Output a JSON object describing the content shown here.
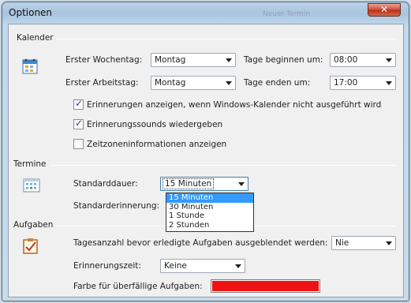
{
  "window": {
    "title": "Optionen",
    "ghost_title": "Neuer Termin"
  },
  "calendar": {
    "section_label": "Kalender",
    "first_weekday_label": "Erster Wochentag:",
    "first_weekday_value": "Montag",
    "first_workday_label": "Erster Arbeitstag:",
    "first_workday_value": "Montag",
    "day_start_label": "Tage beginnen um:",
    "day_start_value": "08:00",
    "day_end_label": "Tage enden um:",
    "day_end_value": "17:00",
    "checkboxes": [
      {
        "label": "Erinnerungen anzeigen, wenn Windows-Kalender nicht ausgeführt wird",
        "checked": true
      },
      {
        "label": "Erinnerungssounds wiedergeben",
        "checked": true
      },
      {
        "label": "Zeitzoneninformationen anzeigen",
        "checked": false
      }
    ]
  },
  "appointments": {
    "section_label": "Termine",
    "default_duration_label": "Standarddauer:",
    "default_duration_value": "15 Minuten",
    "default_reminder_label": "Standarderinnerung:",
    "duration_options": [
      "15 Minuten",
      "30 Minuten",
      "1 Stunde",
      "2 Stunden"
    ]
  },
  "tasks": {
    "section_label": "Aufgaben",
    "hide_days_label": "Tagesanzahl bevor erledigte Aufgaben ausgeblendet werden:",
    "hide_days_value": "Nie",
    "reminder_time_label": "Erinnerungszeit:",
    "reminder_time_value": "Keine",
    "overdue_color_label": "Farbe für überfällige Aufgaben:",
    "overdue_color": "#ee1212"
  },
  "colors": {
    "selection": "#3399ff",
    "close_button": "#c8432b"
  }
}
